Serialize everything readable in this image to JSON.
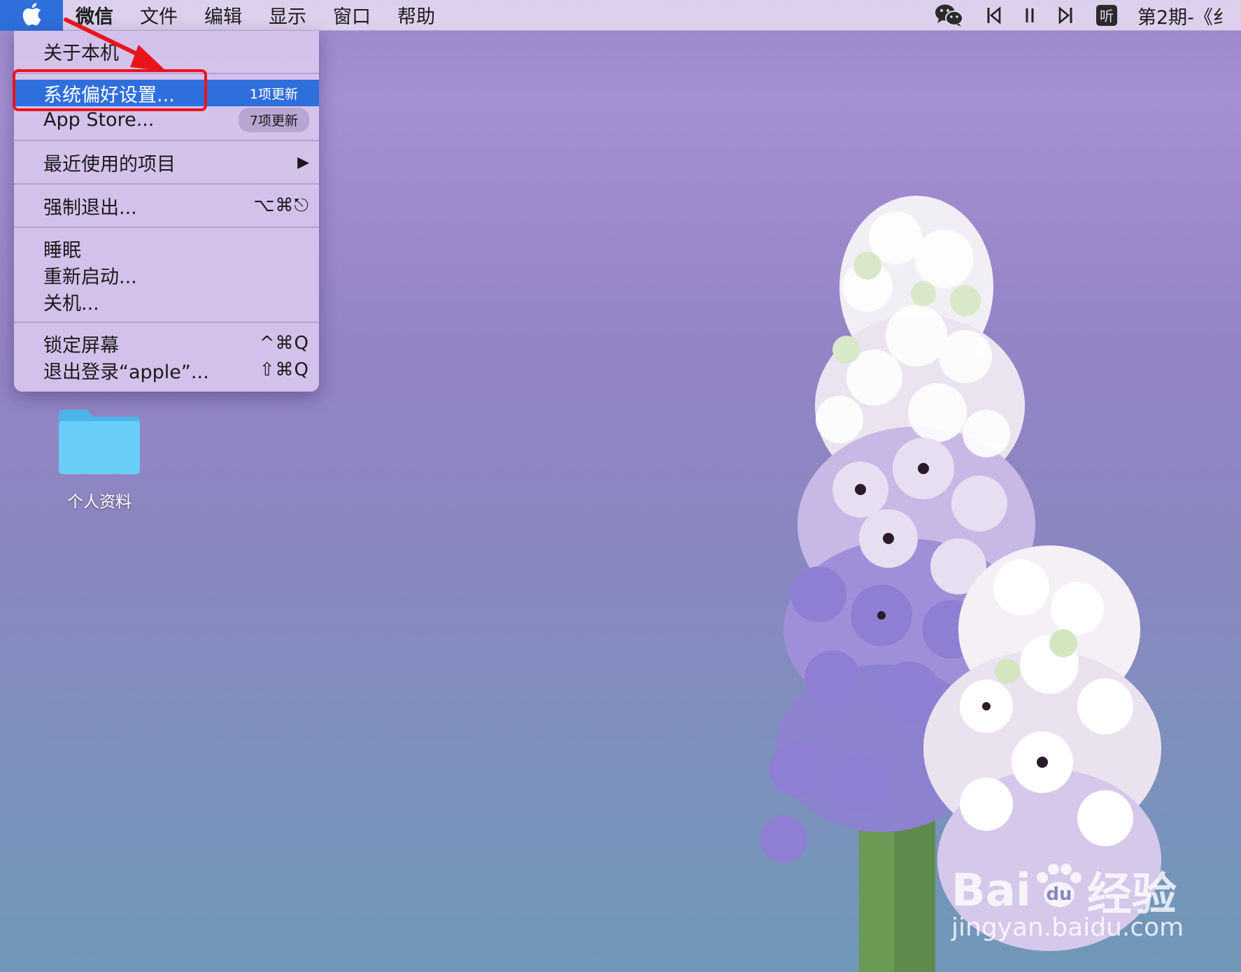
{
  "menubar": {
    "app_name": "微信",
    "menus": [
      "文件",
      "编辑",
      "显示",
      "窗口",
      "帮助"
    ],
    "now_playing": "第2期-《纟"
  },
  "apple_menu": {
    "about": "关于本机",
    "system_prefs": "系统偏好设置...",
    "system_prefs_badge": "1项更新",
    "app_store": "App Store...",
    "app_store_badge": "7项更新",
    "recent_items": "最近使用的项目",
    "force_quit": "强制退出...",
    "force_quit_shortcut": "⌥⌘⎋",
    "sleep": "睡眠",
    "restart": "重新启动...",
    "shutdown": "关机...",
    "lock_screen": "锁定屏幕",
    "lock_screen_shortcut": "^⌘Q",
    "logout": "退出登录“apple”...",
    "logout_shortcut": "⇧⌘Q"
  },
  "desktop": {
    "folder_label": "个人资料"
  },
  "watermark": {
    "brand": "Bai",
    "brand_cn": "经验",
    "url": "jingyan.baidu.com"
  },
  "colors": {
    "selection": "#2f6fdc",
    "annotation_red": "#e8141b",
    "folder_blue": "#5bc3f5"
  }
}
